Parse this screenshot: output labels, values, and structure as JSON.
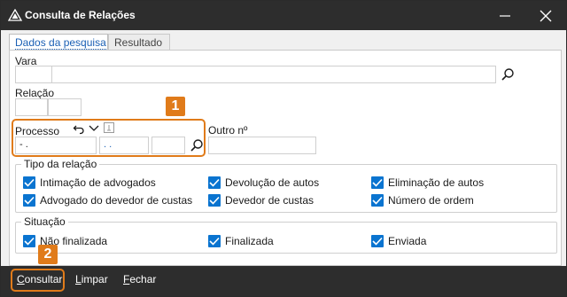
{
  "window": {
    "title": "Consulta de Relações",
    "icon": "app-triangle-icon"
  },
  "tabs": [
    {
      "label": "Dados da pesquisa",
      "active": true
    },
    {
      "label": "Resultado",
      "active": false
    }
  ],
  "form": {
    "vara": {
      "label": "Vara",
      "code": "",
      "value": ""
    },
    "relacao": {
      "label": "Relação",
      "value1": "",
      "value2": ""
    },
    "processo": {
      "label": "Processo",
      "part1": "  -  .",
      "part2": ".  .",
      "part3": ""
    },
    "outro_numero": {
      "label": "Outro nº",
      "value": ""
    }
  },
  "tipo_relacao": {
    "title": "Tipo da relação",
    "options": [
      {
        "label": "Intimação de advogados",
        "checked": true
      },
      {
        "label": "Devolução de autos",
        "checked": true
      },
      {
        "label": "Eliminação de autos",
        "checked": true
      },
      {
        "label": "Advogado do devedor de custas",
        "checked": true
      },
      {
        "label": "Devedor de custas",
        "checked": true
      },
      {
        "label": "Número de ordem",
        "checked": true
      }
    ]
  },
  "situacao": {
    "title": "Situação",
    "options": [
      {
        "label": "Não finalizada",
        "checked": true
      },
      {
        "label": "Finalizada",
        "checked": true
      },
      {
        "label": "Enviada",
        "checked": true
      }
    ]
  },
  "markers": {
    "one": "1",
    "two": "2"
  },
  "footer": {
    "consultar": {
      "first": "C",
      "rest": "onsultar"
    },
    "limpar": {
      "first": "L",
      "rest": "impar"
    },
    "fechar": {
      "first": "F",
      "rest": "echar"
    }
  },
  "colors": {
    "accent": "#e07b1a",
    "checkbox": "#0a74d0",
    "titlebar": "#2d2d2d",
    "tab_active": "#1a5fb4"
  }
}
